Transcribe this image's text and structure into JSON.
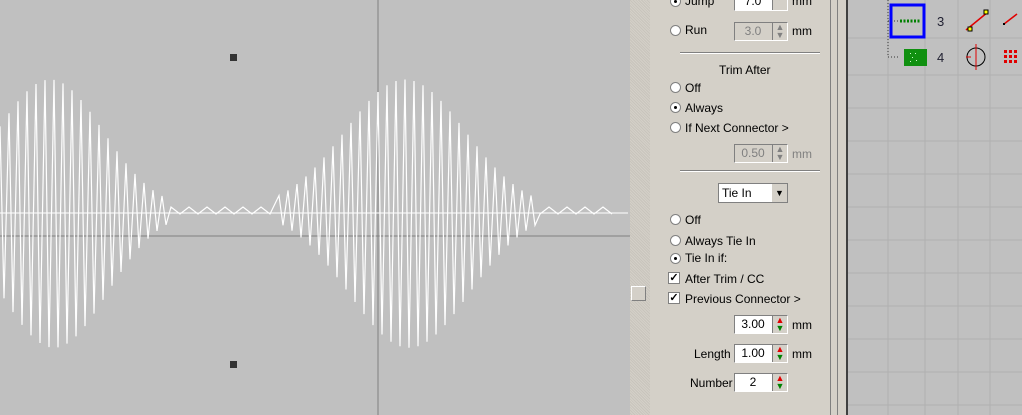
{
  "stitch_options": {
    "jump": {
      "label": "Jump",
      "value": "7.0",
      "unit": "mm",
      "selected": true
    },
    "run": {
      "label": "Run",
      "value": "3.0",
      "unit": "mm",
      "selected": false
    }
  },
  "trim_after": {
    "title": "Trim After",
    "options": [
      {
        "label": "Off",
        "selected": false
      },
      {
        "label": "Always",
        "selected": true
      },
      {
        "label": "If Next Connector >",
        "selected": false
      }
    ],
    "next_connector_value": "0.50",
    "unit": "mm"
  },
  "tie_in": {
    "select_value": "Tie In",
    "options": [
      {
        "label": "Off",
        "selected": false
      },
      {
        "label": "Always Tie In",
        "selected": false
      },
      {
        "label": "Tie In if:",
        "selected": true
      }
    ],
    "checks": [
      {
        "label": "After Trim / CC",
        "checked": true
      },
      {
        "label": "Previous Connector >",
        "checked": true
      }
    ],
    "prev_connector_value": "3.00",
    "length_label": "Length",
    "length_value": "1.00",
    "number_label": "Number",
    "number_value": "2",
    "unit": "mm"
  },
  "object_list": {
    "items": [
      {
        "number": "3",
        "icon": "satin-run-icon"
      },
      {
        "number": "4",
        "icon": "fill-block-icon"
      }
    ]
  },
  "colors": {
    "panel": "#d4d0c8",
    "canvas": "#c0c0c0",
    "selection": "#0000ff",
    "stitch_green": "#008000"
  }
}
